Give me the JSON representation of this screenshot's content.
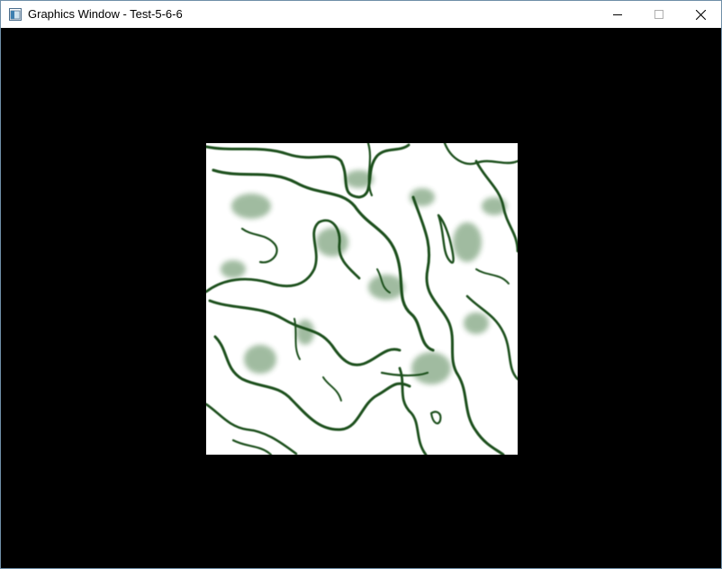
{
  "window": {
    "title": "Graphics Window - Test-5-6-6",
    "app_icon": "app-window-icon",
    "controls": {
      "minimize_icon": "minimize-icon",
      "maximize_icon": "maximize-icon",
      "close_icon": "close-icon"
    }
  },
  "viewport": {
    "background_color": "#000000",
    "texture": {
      "description_icon": "marble-texture",
      "base_color": "#ffffff",
      "vein_color": "#1f5a1f"
    }
  }
}
